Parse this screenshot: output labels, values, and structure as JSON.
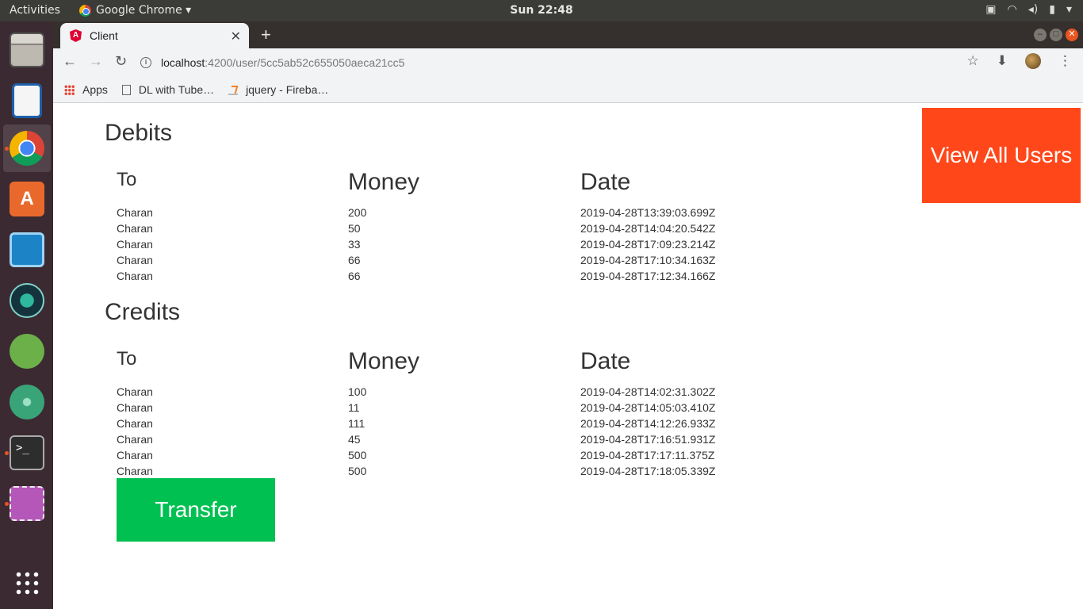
{
  "topbar": {
    "activities": "Activities",
    "app_name": "Google Chrome ▾",
    "clock": "Sun 22:48"
  },
  "browser": {
    "tab_title": "Client",
    "url_host": "localhost",
    "url_rest": ":4200/user/5cc5ab52c655050aeca21cc5",
    "bookmarks": [
      "Apps",
      "DL with Tube…",
      "jquery - Fireba…"
    ]
  },
  "page": {
    "view_all_label": "View All Users",
    "transfer_label": "Transfer",
    "debits": {
      "title": "Debits",
      "headers": [
        "To",
        "Money",
        "Date"
      ],
      "rows": [
        [
          "Charan",
          "200",
          "2019-04-28T13:39:03.699Z"
        ],
        [
          "Charan",
          "50",
          "2019-04-28T14:04:20.542Z"
        ],
        [
          "Charan",
          "33",
          "2019-04-28T17:09:23.214Z"
        ],
        [
          "Charan",
          "66",
          "2019-04-28T17:10:34.163Z"
        ],
        [
          "Charan",
          "66",
          "2019-04-28T17:12:34.166Z"
        ]
      ]
    },
    "credits": {
      "title": "Credits",
      "headers": [
        "To",
        "Money",
        "Date"
      ],
      "rows": [
        [
          "Charan",
          "100",
          "2019-04-28T14:02:31.302Z"
        ],
        [
          "Charan",
          "11",
          "2019-04-28T14:05:03.410Z"
        ],
        [
          "Charan",
          "111",
          "2019-04-28T14:12:26.933Z"
        ],
        [
          "Charan",
          "45",
          "2019-04-28T17:16:51.931Z"
        ],
        [
          "Charan",
          "500",
          "2019-04-28T17:17:11.375Z"
        ],
        [
          "Charan",
          "500",
          "2019-04-28T17:18:05.339Z"
        ]
      ]
    }
  },
  "colors": {
    "view_all": "#ff471a",
    "transfer": "#00c051"
  }
}
